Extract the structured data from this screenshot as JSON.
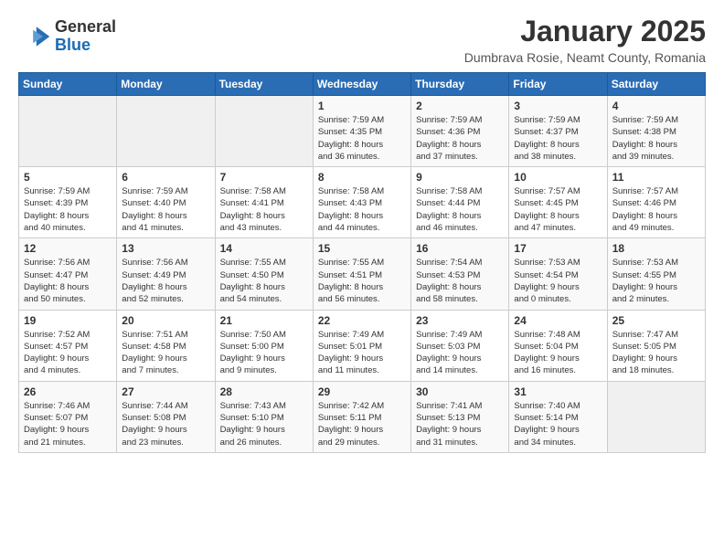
{
  "header": {
    "logo_general": "General",
    "logo_blue": "Blue",
    "month_title": "January 2025",
    "location": "Dumbrava Rosie, Neamt County, Romania"
  },
  "weekdays": [
    "Sunday",
    "Monday",
    "Tuesday",
    "Wednesday",
    "Thursday",
    "Friday",
    "Saturday"
  ],
  "weeks": [
    [
      {
        "day": "",
        "info": ""
      },
      {
        "day": "",
        "info": ""
      },
      {
        "day": "",
        "info": ""
      },
      {
        "day": "1",
        "info": "Sunrise: 7:59 AM\nSunset: 4:35 PM\nDaylight: 8 hours\nand 36 minutes."
      },
      {
        "day": "2",
        "info": "Sunrise: 7:59 AM\nSunset: 4:36 PM\nDaylight: 8 hours\nand 37 minutes."
      },
      {
        "day": "3",
        "info": "Sunrise: 7:59 AM\nSunset: 4:37 PM\nDaylight: 8 hours\nand 38 minutes."
      },
      {
        "day": "4",
        "info": "Sunrise: 7:59 AM\nSunset: 4:38 PM\nDaylight: 8 hours\nand 39 minutes."
      }
    ],
    [
      {
        "day": "5",
        "info": "Sunrise: 7:59 AM\nSunset: 4:39 PM\nDaylight: 8 hours\nand 40 minutes."
      },
      {
        "day": "6",
        "info": "Sunrise: 7:59 AM\nSunset: 4:40 PM\nDaylight: 8 hours\nand 41 minutes."
      },
      {
        "day": "7",
        "info": "Sunrise: 7:58 AM\nSunset: 4:41 PM\nDaylight: 8 hours\nand 43 minutes."
      },
      {
        "day": "8",
        "info": "Sunrise: 7:58 AM\nSunset: 4:43 PM\nDaylight: 8 hours\nand 44 minutes."
      },
      {
        "day": "9",
        "info": "Sunrise: 7:58 AM\nSunset: 4:44 PM\nDaylight: 8 hours\nand 46 minutes."
      },
      {
        "day": "10",
        "info": "Sunrise: 7:57 AM\nSunset: 4:45 PM\nDaylight: 8 hours\nand 47 minutes."
      },
      {
        "day": "11",
        "info": "Sunrise: 7:57 AM\nSunset: 4:46 PM\nDaylight: 8 hours\nand 49 minutes."
      }
    ],
    [
      {
        "day": "12",
        "info": "Sunrise: 7:56 AM\nSunset: 4:47 PM\nDaylight: 8 hours\nand 50 minutes."
      },
      {
        "day": "13",
        "info": "Sunrise: 7:56 AM\nSunset: 4:49 PM\nDaylight: 8 hours\nand 52 minutes."
      },
      {
        "day": "14",
        "info": "Sunrise: 7:55 AM\nSunset: 4:50 PM\nDaylight: 8 hours\nand 54 minutes."
      },
      {
        "day": "15",
        "info": "Sunrise: 7:55 AM\nSunset: 4:51 PM\nDaylight: 8 hours\nand 56 minutes."
      },
      {
        "day": "16",
        "info": "Sunrise: 7:54 AM\nSunset: 4:53 PM\nDaylight: 8 hours\nand 58 minutes."
      },
      {
        "day": "17",
        "info": "Sunrise: 7:53 AM\nSunset: 4:54 PM\nDaylight: 9 hours\nand 0 minutes."
      },
      {
        "day": "18",
        "info": "Sunrise: 7:53 AM\nSunset: 4:55 PM\nDaylight: 9 hours\nand 2 minutes."
      }
    ],
    [
      {
        "day": "19",
        "info": "Sunrise: 7:52 AM\nSunset: 4:57 PM\nDaylight: 9 hours\nand 4 minutes."
      },
      {
        "day": "20",
        "info": "Sunrise: 7:51 AM\nSunset: 4:58 PM\nDaylight: 9 hours\nand 7 minutes."
      },
      {
        "day": "21",
        "info": "Sunrise: 7:50 AM\nSunset: 5:00 PM\nDaylight: 9 hours\nand 9 minutes."
      },
      {
        "day": "22",
        "info": "Sunrise: 7:49 AM\nSunset: 5:01 PM\nDaylight: 9 hours\nand 11 minutes."
      },
      {
        "day": "23",
        "info": "Sunrise: 7:49 AM\nSunset: 5:03 PM\nDaylight: 9 hours\nand 14 minutes."
      },
      {
        "day": "24",
        "info": "Sunrise: 7:48 AM\nSunset: 5:04 PM\nDaylight: 9 hours\nand 16 minutes."
      },
      {
        "day": "25",
        "info": "Sunrise: 7:47 AM\nSunset: 5:05 PM\nDaylight: 9 hours\nand 18 minutes."
      }
    ],
    [
      {
        "day": "26",
        "info": "Sunrise: 7:46 AM\nSunset: 5:07 PM\nDaylight: 9 hours\nand 21 minutes."
      },
      {
        "day": "27",
        "info": "Sunrise: 7:44 AM\nSunset: 5:08 PM\nDaylight: 9 hours\nand 23 minutes."
      },
      {
        "day": "28",
        "info": "Sunrise: 7:43 AM\nSunset: 5:10 PM\nDaylight: 9 hours\nand 26 minutes."
      },
      {
        "day": "29",
        "info": "Sunrise: 7:42 AM\nSunset: 5:11 PM\nDaylight: 9 hours\nand 29 minutes."
      },
      {
        "day": "30",
        "info": "Sunrise: 7:41 AM\nSunset: 5:13 PM\nDaylight: 9 hours\nand 31 minutes."
      },
      {
        "day": "31",
        "info": "Sunrise: 7:40 AM\nSunset: 5:14 PM\nDaylight: 9 hours\nand 34 minutes."
      },
      {
        "day": "",
        "info": ""
      }
    ]
  ]
}
